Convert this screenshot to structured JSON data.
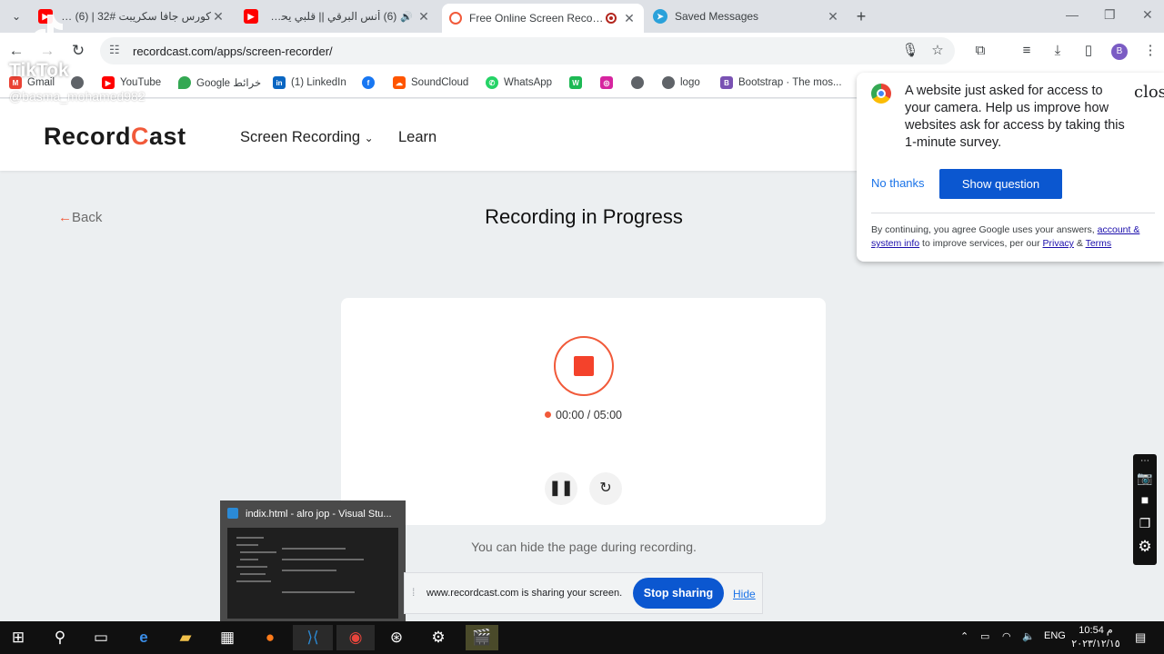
{
  "browser": {
    "tabs": [
      {
        "title": "كورس جافا سكريبت #32 | (6) be",
        "favicon": "youtube-icon",
        "color": "#ff0000"
      },
      {
        "title": "(6) أنس البرقي || قلبي يحدث",
        "favicon": "youtube-icon",
        "color": "#ff0000",
        "audio": true
      },
      {
        "title": "Free Online Screen Recorde",
        "favicon": "recordcast-icon",
        "color": "#f15a3a",
        "active": true,
        "recording": true
      },
      {
        "title": "Saved Messages",
        "favicon": "telegram-icon",
        "color": "#2aa1da"
      }
    ],
    "url": "recordcast.com/apps/screen-recorder/",
    "profile_initial": "B",
    "bookmarks": [
      {
        "label": "Gmail",
        "icon": "gmail-icon",
        "color": "#ea4335"
      },
      {
        "label": "",
        "icon": "globe-icon",
        "color": "#5f6368"
      },
      {
        "label": "YouTube",
        "icon": "youtube-icon",
        "color": "#ff0000"
      },
      {
        "label": "Google خرائط",
        "icon": "maps-icon",
        "color": "#34a853"
      },
      {
        "label": "(1) LinkedIn",
        "icon": "linkedin-icon",
        "color": "#0a66c2"
      },
      {
        "label": "",
        "icon": "facebook-icon",
        "color": "#1877f2"
      },
      {
        "label": "SoundCloud",
        "icon": "soundcloud-icon",
        "color": "#ff5500"
      },
      {
        "label": "WhatsApp",
        "icon": "whatsapp-icon",
        "color": "#25d366"
      },
      {
        "label": "",
        "icon": "w-icon",
        "color": "#1db954"
      },
      {
        "label": "",
        "icon": "instagram-icon",
        "color": "#d6249f"
      },
      {
        "label": "",
        "icon": "globe-icon",
        "color": "#5f6368"
      },
      {
        "label": "logo",
        "icon": "globe-icon",
        "color": "#5f6368"
      },
      {
        "label": "Bootstrap · The mos...",
        "icon": "bootstrap-icon",
        "color": "#7952b3"
      }
    ]
  },
  "site": {
    "logo_left": "Record",
    "logo_c": "C",
    "logo_right": "ast",
    "nav": [
      {
        "label": "Screen Recording",
        "dropdown": true
      },
      {
        "label": "Learn"
      }
    ],
    "back": "Back",
    "heading": "Recording in Progress",
    "timer": "00:00 / 05:00",
    "hint": "You can hide the page during recording.",
    "accent": "#f15a3a"
  },
  "survey": {
    "message": "A website just asked for access to your camera. Help us improve how websites ask for access by taking this 1-minute survey.",
    "close": "clos",
    "no_thanks": "No thanks",
    "show_question": "Show question",
    "footer_pre": "By continuing, you agree Google uses your answers, ",
    "footer_link1": "account & system info",
    "footer_mid": " to improve services, per our ",
    "footer_link2": "Privacy",
    "footer_amp": " & ",
    "footer_link3": "Terms"
  },
  "sharing_bar": {
    "text": "www.recordcast.com is sharing your screen.",
    "stop": "Stop sharing",
    "hide": "Hide"
  },
  "thumbnail": {
    "title": "indix.html - alro jop - Visual Stu..."
  },
  "watermark": {
    "brand": "TikTok",
    "user": "@basma_mohamed982"
  },
  "taskbar": {
    "lang": "ENG",
    "time": "10:54 م",
    "date": "٢٠٢٣/١٢/١٥"
  }
}
